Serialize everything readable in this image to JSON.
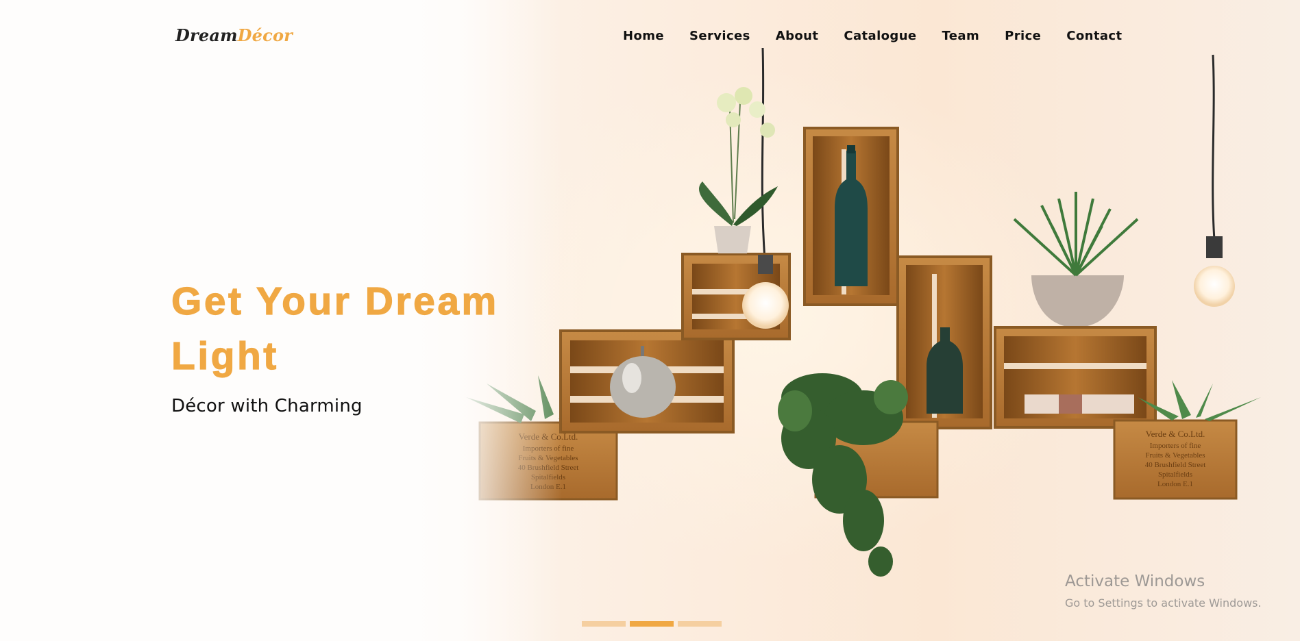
{
  "brand": {
    "logo_part1": "Dream",
    "logo_part2": "Décor",
    "accent_color": "#f0a843"
  },
  "nav": {
    "items": [
      {
        "label": "Home"
      },
      {
        "label": "Services"
      },
      {
        "label": "About"
      },
      {
        "label": "Catalogue"
      },
      {
        "label": "Team"
      },
      {
        "label": "Price"
      },
      {
        "label": "Contact"
      }
    ]
  },
  "hero": {
    "title_line1": "Get Your Dream",
    "title_line2": "Light",
    "subtitle": "Décor with Charming",
    "crate_text": [
      "Verde & Co.Ltd.",
      "Importers of fine",
      "Fruits & Vegetables",
      "40 Brushfield Street",
      "Spitalfields",
      "London E.1"
    ]
  },
  "slider": {
    "slide_count": 3,
    "active_index": 1
  },
  "watermark": {
    "title": "Activate Windows",
    "subtitle": "Go to Settings to activate Windows."
  }
}
